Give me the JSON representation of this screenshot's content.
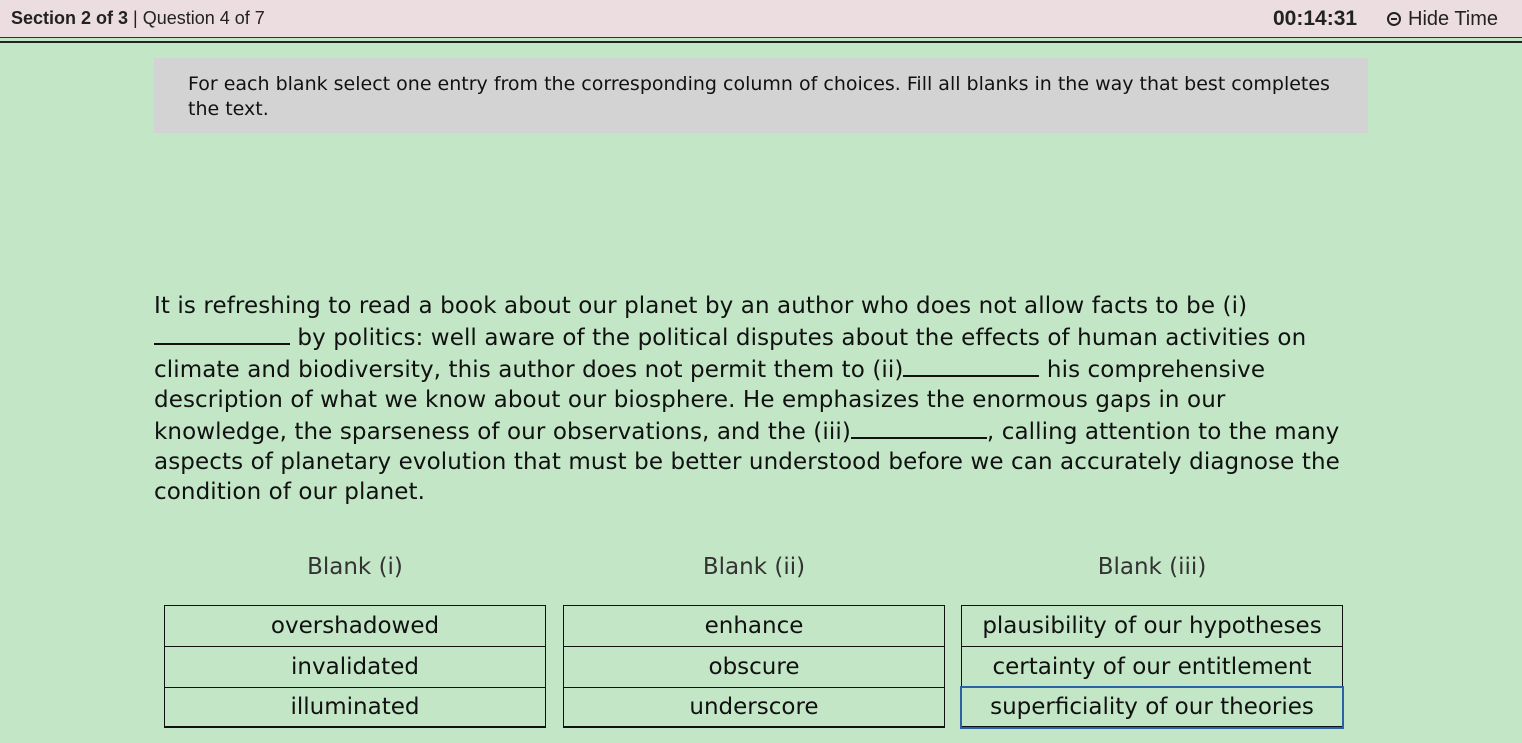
{
  "header": {
    "section_label": "Section 2 of 3",
    "separator": " | ",
    "question_label": "Question 4 of 7",
    "timer": "00:14:31",
    "hide_time_label": "Hide Time"
  },
  "instructions": "For each blank select one entry from the corresponding column of choices. Fill all blanks in the way that best completes the text.",
  "passage": {
    "part1": "It is refreshing to read a book about our planet by an author who does not allow facts to be (i)",
    "part2": " by politics: well aware of the political disputes about the effects of human activities on climate and biodiversity, this author does not permit them to (ii)",
    "part3": " his comprehensive description of what we know about our biosphere. He emphasizes the enormous gaps in our knowledge, the sparseness of our observations, and the (iii)",
    "part4": ", calling attention to the many aspects of planetary evolution that must be better understood before we can accurately diagnose the condition of our planet."
  },
  "columns": [
    {
      "header": "Blank (i)",
      "choices": [
        "overshadowed",
        "invalidated",
        "illuminated"
      ]
    },
    {
      "header": "Blank (ii)",
      "choices": [
        "enhance",
        "obscure",
        "underscore"
      ]
    },
    {
      "header": "Blank (iii)",
      "choices": [
        "plausibility of our hypotheses",
        "certainty of our entitlement",
        "superficiality of our theories"
      ],
      "selected_index": 2
    }
  ]
}
